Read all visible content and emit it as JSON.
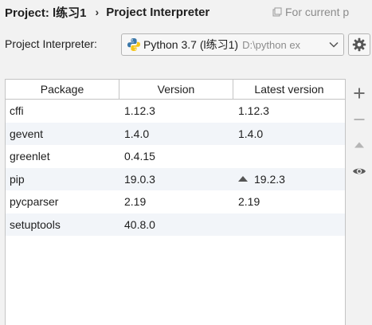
{
  "breadcrumb": {
    "project": "Project: l练习1",
    "separator": "›",
    "page": "Project Interpreter"
  },
  "scope_hint": "For current p",
  "interpreter": {
    "label": "Project Interpreter:",
    "name": "Python 3.7 (l练习1)",
    "path": "D:\\python ex"
  },
  "table": {
    "columns": [
      "Package",
      "Version",
      "Latest version"
    ],
    "rows": [
      {
        "package": "cffi",
        "version": "1.12.3",
        "latest": "1.12.3",
        "upgrade": false
      },
      {
        "package": "gevent",
        "version": "1.4.0",
        "latest": "1.4.0",
        "upgrade": false
      },
      {
        "package": "greenlet",
        "version": "0.4.15",
        "latest": "",
        "upgrade": false
      },
      {
        "package": "pip",
        "version": "19.0.3",
        "latest": "19.2.3",
        "upgrade": true
      },
      {
        "package": "pycparser",
        "version": "2.19",
        "latest": "2.19",
        "upgrade": false
      },
      {
        "package": "setuptools",
        "version": "40.8.0",
        "latest": "",
        "upgrade": false
      }
    ]
  },
  "toolbar": {
    "add_icon": "plus-icon",
    "remove_icon": "minus-icon",
    "upgrade_icon": "triangle-up-icon",
    "show_icon": "eye-icon"
  },
  "colors": {
    "background": "#f2f2f2",
    "table_bg": "#ffffff",
    "row_alt": "#f2f5f9",
    "muted_text": "#8c8c8c",
    "python_blue": "#3b77a8",
    "python_yellow": "#f5c518"
  }
}
